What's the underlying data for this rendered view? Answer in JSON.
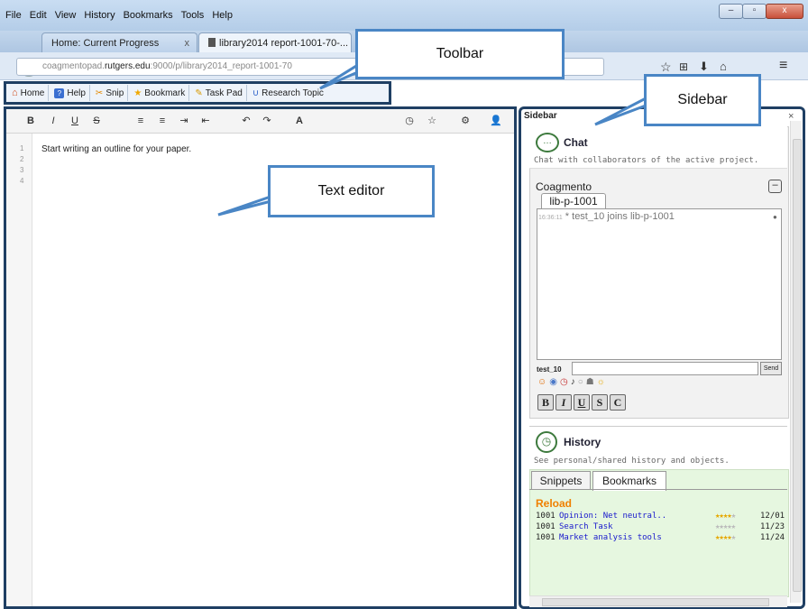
{
  "menu": [
    "File",
    "Edit",
    "View",
    "History",
    "Bookmarks",
    "Tools",
    "Help"
  ],
  "window_buttons": [
    "–",
    "▫",
    "x"
  ],
  "tabs": [
    {
      "label": "Home: Current Progress",
      "close": "x"
    },
    {
      "label": "library2014 report-1001-70-..."
    }
  ],
  "url": {
    "prefix": "coagmentopad.",
    "domain": "rutgers.edu",
    "suffix": ":9000/p/library2014_report-1001-70"
  },
  "toolbar": {
    "items": [
      {
        "label": "Home",
        "icon": "home-icon"
      },
      {
        "label": "Help",
        "icon": "help-icon"
      },
      {
        "label": "Snip",
        "icon": "snip-icon"
      },
      {
        "label": "Bookmark",
        "icon": "star-icon"
      },
      {
        "label": "Task Pad",
        "icon": "taskpad-icon"
      },
      {
        "label": "Research Topic",
        "icon": "research-topic-icon"
      }
    ]
  },
  "editor": {
    "buttons": [
      "B",
      "I",
      "U",
      "S",
      "≡",
      "≡",
      "⇥",
      "⇤",
      "↶",
      "↷",
      "A"
    ],
    "line_numbers": [
      "1",
      "2",
      "3",
      "4"
    ],
    "content": "Start writing an outline for your paper."
  },
  "sidebar": {
    "title": "Sidebar",
    "close": "×",
    "chat": {
      "title": "Chat",
      "subtitle": "Chat with collaborators of the active project.",
      "group": "Coagmento",
      "minimize": "–",
      "room_tab": "lib-p-1001",
      "messages": [
        {
          "time": "16:36:11",
          "text": "* test_10 joins lib-p-1001"
        }
      ],
      "user": "test_10",
      "send_label": "Send",
      "format_buttons": [
        "B",
        "I",
        "U",
        "S",
        "C"
      ]
    },
    "history": {
      "title": "History",
      "subtitle": "See personal/shared history and objects.",
      "tabs": [
        "Snippets",
        "Bookmarks"
      ],
      "active_tab": "Bookmarks",
      "reload_label": "Reload",
      "rows": [
        {
          "id": "1001",
          "title": "Opinion: Net neutral..",
          "rating": 4,
          "date": "12/01"
        },
        {
          "id": "1001",
          "title": "Search Task",
          "rating": 0,
          "date": "11/23"
        },
        {
          "id": "1001",
          "title": "Market analysis tools",
          "rating": 4,
          "date": "11/24"
        }
      ]
    }
  },
  "callouts": {
    "toolbar": "Toolbar",
    "sidebar": "Sidebar",
    "editor": "Text editor"
  },
  "colors": {
    "frame": "#1f3f63",
    "callout_border": "#4a86c5",
    "reload": "#f08000",
    "link": "#1a1acc"
  }
}
